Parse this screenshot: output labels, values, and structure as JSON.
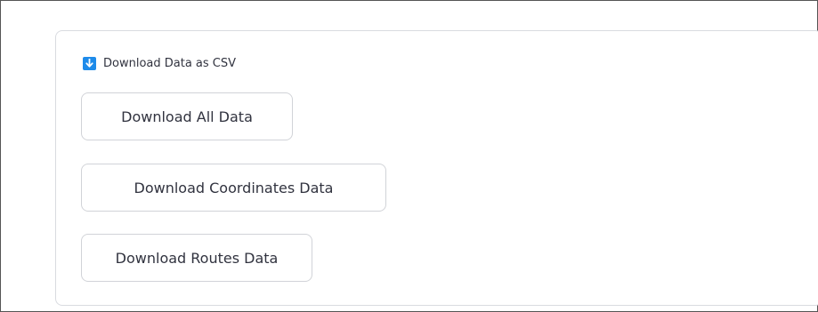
{
  "section": {
    "icon": "down-arrow-icon",
    "title": "Download Data as CSV"
  },
  "buttons": {
    "all": "Download All Data",
    "coordinates": "Download Coordinates Data",
    "routes": "Download Routes Data"
  },
  "colors": {
    "icon_bg": "#1e8bea",
    "text": "#31333f",
    "border": "#d1d3d8"
  }
}
